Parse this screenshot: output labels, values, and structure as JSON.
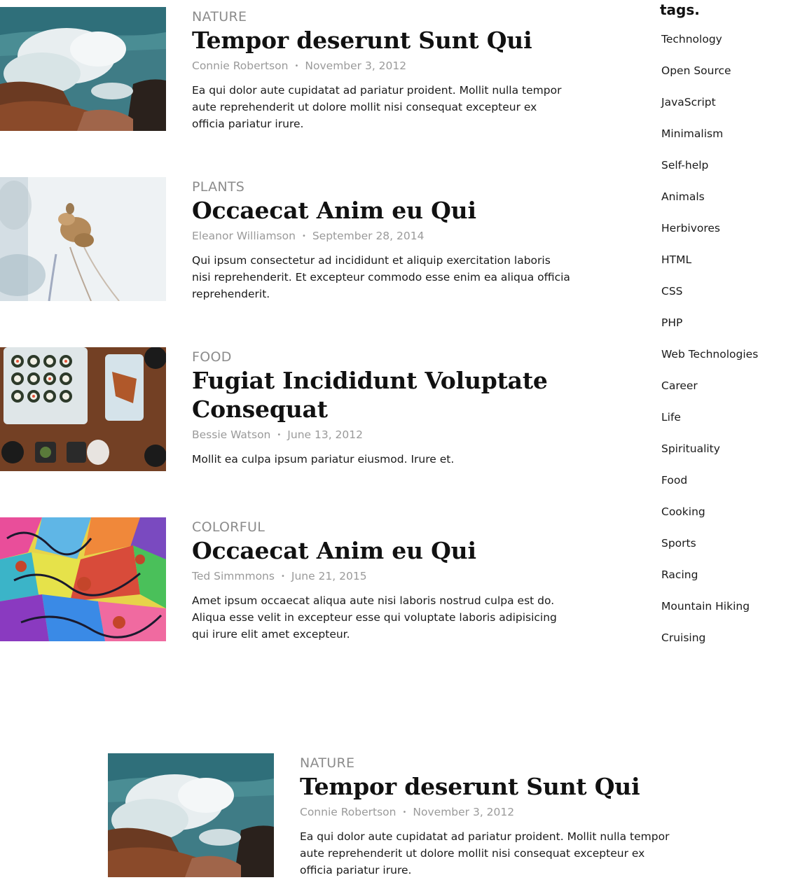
{
  "posts": [
    {
      "category": "NATURE",
      "title": "Tempor deserunt Sunt Qui",
      "author": "Connie Robertson",
      "separator": "•",
      "date": "November 3, 2012",
      "excerpt": "Ea qui dolor aute cupidatat ad pariatur proident. Mollit nulla tempor aute reprehenderit ut dolore mollit nisi consequat excepteur ex officia pariatur irure.",
      "image": "ocean-wave-rocks-photo"
    },
    {
      "category": "PLANTS",
      "title": "Occaecat Anim eu Qui",
      "author": "Eleanor Williamson",
      "separator": "•",
      "date": "September 28, 2014",
      "excerpt": "Qui ipsum consectetur ad incididunt et aliquip exercitation laboris nisi reprehenderit. Et excepteur commodo esse enim ea aliqua officia reprehenderit.",
      "image": "dried-grass-plant-photo"
    },
    {
      "category": "FOOD",
      "title": "Fugiat Incididunt Voluptate Consequat",
      "author": "Bessie Watson",
      "separator": "•",
      "date": "June 13, 2012",
      "excerpt": "Mollit ea culpa ipsum pariatur eiusmod. Irure et.",
      "image": "sushi-table-photo"
    },
    {
      "category": "COLORFUL",
      "title": "Occaecat Anim eu Qui",
      "author": "Ted Simmmons",
      "separator": "•",
      "date": "June 21, 2015",
      "excerpt": "Amet ipsum occaecat aliqua aute nisi laboris nostrud culpa est do. Aliqua esse velit in excepteur esse qui voluptate laboris adipisicing qui irure elit amet excepteur.",
      "image": "graffiti-art-photo"
    }
  ],
  "featured": {
    "category": "NATURE",
    "title": "Tempor deserunt Sunt Qui",
    "author": "Connie Robertson",
    "separator": "•",
    "date": "November 3, 2012",
    "excerpt": "Ea qui dolor aute cupidatat ad pariatur proident. Mollit nulla tempor aute reprehenderit ut dolore mollit nisi consequat excepteur ex officia pariatur irure.",
    "image": "ocean-wave-rocks-photo"
  },
  "sidebar": {
    "title": "tags.",
    "tags": [
      "Technology",
      "Open Source",
      "JavaScript",
      "Minimalism",
      "Self-help",
      "Animals",
      "Herbivores",
      "HTML",
      "CSS",
      "PHP",
      "Web Technologies",
      "Career",
      "Life",
      "Spirituality",
      "Food",
      "Cooking",
      "Sports",
      "Racing",
      "Mountain Hiking",
      "Cruising"
    ]
  }
}
